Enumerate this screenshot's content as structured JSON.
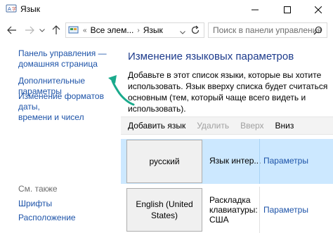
{
  "window": {
    "title": "Язык",
    "minimize_glyph": "—",
    "maximize_glyph": "☐",
    "close_glyph": "✕"
  },
  "nav": {
    "address_crumbs": [
      "«",
      "Все элем...",
      "›",
      "Язык"
    ],
    "search_placeholder": "Поиск в панели управления"
  },
  "left_pane": {
    "link_control_panel": "Панель управления —\nдомашняя страница",
    "link_advanced": "Дополнительные параметры",
    "link_formats": "Изменение форматов даты,\nвремени и чисел",
    "see_also": "См. также",
    "link_fonts": "Шрифты",
    "link_location": "Расположение"
  },
  "main": {
    "heading": "Изменение языковых параметров",
    "description": "Добавьте в этот список языки, которые вы хотите использовать. Язык вверху списка будет считаться основным (тем, который чаще всего видеть и использовать).",
    "toolbar": {
      "add": "Добавить язык",
      "remove": "Удалить",
      "up": "Вверх",
      "down": "Вниз"
    },
    "languages": [
      {
        "name": "русский",
        "info": "Язык интер...",
        "params": "Параметры",
        "selected": true
      },
      {
        "name": "English (United States)",
        "info": "Раскладка\nклавиатуры:\nСША",
        "params": "Параметры",
        "selected": false
      }
    ]
  },
  "colors": {
    "link": "#1d53a8",
    "heading": "#1d3b8c",
    "selection": "#cce8ff",
    "arrow": "#1aaa8c"
  }
}
